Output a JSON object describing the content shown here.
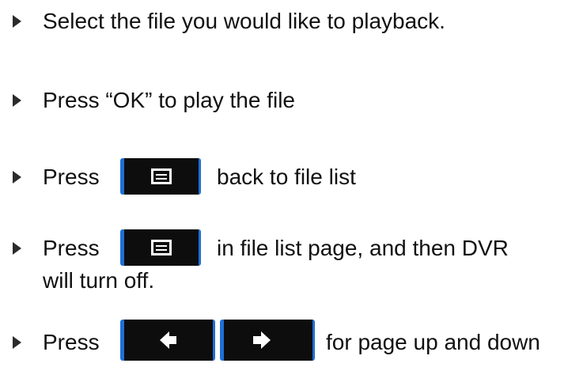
{
  "instructions": {
    "select_file": "Select the file you would like to playback.",
    "press_ok": "Press “OK” to play the file",
    "back_press": "Press",
    "back_after": "back to file list",
    "off_press": "Press",
    "off_after_line1": "in file list page, and then DVR",
    "off_after_line2": "will turn off.",
    "page_press": "Press",
    "page_after": "for page up and down"
  },
  "icons": {
    "bullet": "triangle-bullet-icon",
    "menu_button": "menu-button-icon",
    "left_button": "left-arrow-button-icon",
    "right_button": "right-arrow-button-icon"
  },
  "colors": {
    "text": "#111111",
    "button_fill": "#0d0d0d",
    "button_edge": "#1f6fd6",
    "glyph": "#ffffff"
  }
}
